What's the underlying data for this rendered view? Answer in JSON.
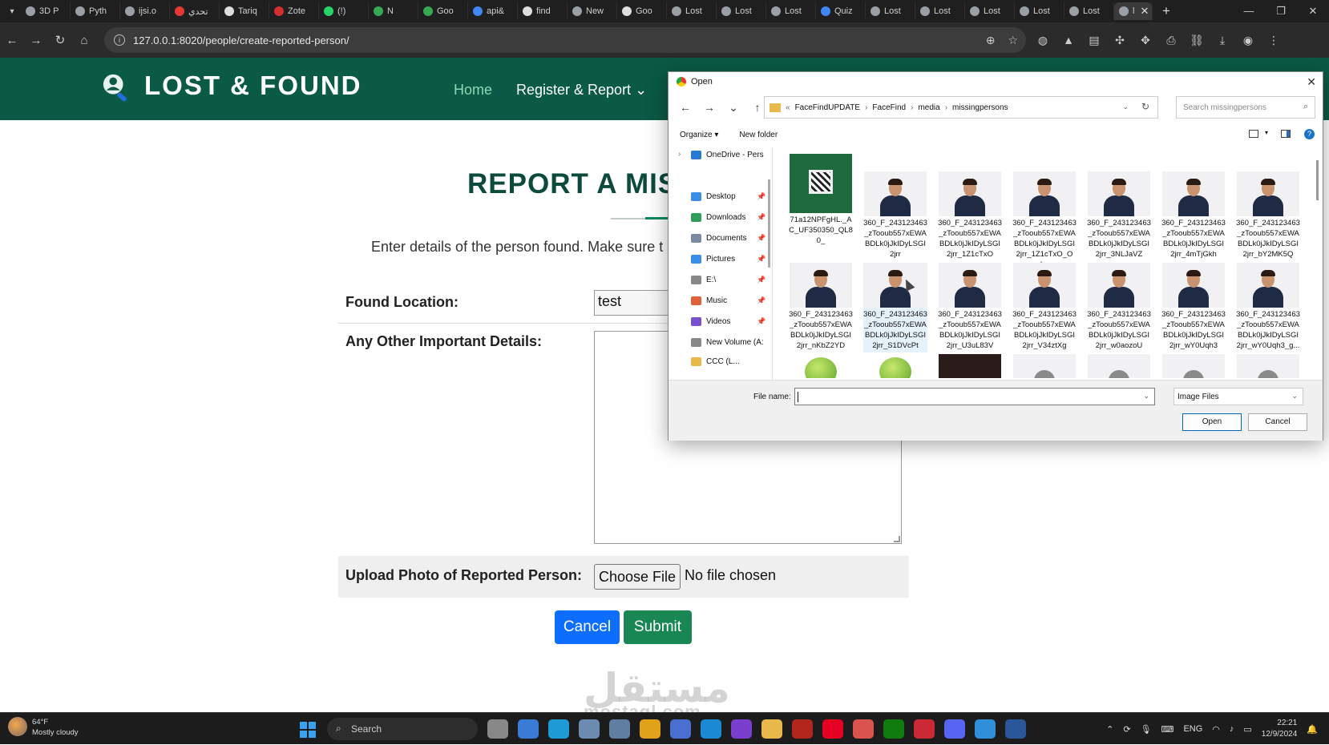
{
  "browser": {
    "tabs": [
      {
        "label": "3D P",
        "color": "#9aa0a6"
      },
      {
        "label": "Pyth",
        "color": "#9aa0a6"
      },
      {
        "label": "ijsi.o",
        "color": "#9aa0a6"
      },
      {
        "label": "تحدي",
        "color": "#e53935"
      },
      {
        "label": "Tariq",
        "color": "#dddddd"
      },
      {
        "label": "Zote",
        "color": "#d32f2f"
      },
      {
        "label": "(!)",
        "color": "#25d366"
      },
      {
        "label": "N",
        "color": "#34a853"
      },
      {
        "label": "Goo",
        "color": "#34a853"
      },
      {
        "label": "api&",
        "color": "#4285f4"
      },
      {
        "label": "find",
        "color": "#dddddd"
      },
      {
        "label": "New",
        "color": "#9aa0a6"
      },
      {
        "label": "Goo",
        "color": "#dddddd"
      },
      {
        "label": "Lost",
        "color": "#9aa0a6"
      },
      {
        "label": "Lost",
        "color": "#9aa0a6"
      },
      {
        "label": "Lost",
        "color": "#9aa0a6"
      },
      {
        "label": "Quiz",
        "color": "#4285f4"
      },
      {
        "label": "Lost",
        "color": "#9aa0a6"
      },
      {
        "label": "Lost",
        "color": "#9aa0a6"
      },
      {
        "label": "Lost",
        "color": "#9aa0a6"
      },
      {
        "label": "Lost",
        "color": "#9aa0a6"
      },
      {
        "label": "Lost",
        "color": "#9aa0a6"
      },
      {
        "label": "l",
        "color": "#9aa0a6",
        "active": true
      }
    ],
    "url": "127.0.0.1:8020/people/create-reported-person/"
  },
  "site": {
    "logo_text": "LOST & FOUND",
    "nav_home": "Home",
    "nav_register": "Register & Report",
    "nav_register_icon": "chevron-down-icon",
    "brand_color": "#0a5a45"
  },
  "form": {
    "title": "REPORT A MIS",
    "intro": "Enter details of the person found. Make sure t",
    "found_location_label": "Found Location:",
    "found_location_value": "test",
    "details_label": "Any Other Important Details:",
    "upload_label": "Upload Photo of Reported Person:",
    "choose_file": "Choose File",
    "no_file": "No file chosen",
    "cancel": "Cancel",
    "submit": "Submit"
  },
  "watermark": {
    "arabic": "مستقل",
    "latin": "mostaql.com"
  },
  "dialog": {
    "title": "Open",
    "path": [
      "FaceFindUPDATE",
      "FaceFind",
      "media",
      "missingpersons"
    ],
    "path_prefix": "«",
    "search_placeholder": "Search missingpersons",
    "organize": "Organize",
    "new_folder": "New folder",
    "tree": [
      {
        "label": "OneDrive - Pers",
        "color": "#2a7ad5",
        "pinned": false
      },
      {
        "label": "Desktop",
        "color": "#3a8ee6",
        "pinned": true
      },
      {
        "label": "Downloads",
        "color": "#2f9e5b",
        "pinned": true
      },
      {
        "label": "Documents",
        "color": "#7a8aa0",
        "pinned": true
      },
      {
        "label": "Pictures",
        "color": "#3a8ee6",
        "pinned": true
      },
      {
        "label": "E:\\",
        "color": "#888888",
        "pinned": true
      },
      {
        "label": "Music",
        "color": "#e0623a",
        "pinned": true
      },
      {
        "label": "Videos",
        "color": "#7a4fd0",
        "pinned": true
      },
      {
        "label": "New Volume (A:",
        "color": "#888888",
        "pinned": false
      },
      {
        "label": "CCC (L...",
        "color": "#e9b84a",
        "pinned": false
      }
    ],
    "files": [
      {
        "name": "71a12NPFgHL._AC_UF350350_QL80_",
        "kind": "bag"
      },
      {
        "name": "360_F_243123463_zTooub557xEWABDLk0jJkIDyLSGI2jrr",
        "kind": "person"
      },
      {
        "name": "360_F_243123463_zTooub557xEWABDLk0jJkIDyLSGI2jrr_1Z1cTxO",
        "kind": "person"
      },
      {
        "name": "360_F_243123463_zTooub557xEWABDLk0jJkIDyLSGI2jrr_1Z1cTxO_Ol...",
        "kind": "person"
      },
      {
        "name": "360_F_243123463_zTooub557xEWABDLk0jJkIDyLSGI2jrr_3NLJaVZ",
        "kind": "person"
      },
      {
        "name": "360_F_243123463_zTooub557xEWABDLk0jJkIDyLSGI2jrr_4mTjGkh",
        "kind": "person"
      },
      {
        "name": "360_F_243123463_zTooub557xEWABDLk0jJkIDyLSGI2jrr_bY2MK5Q",
        "kind": "person"
      },
      {
        "name": "360_F_243123463_zTooub557xEWABDLk0jJkIDyLSGI2jrr_nKbZ2YD",
        "kind": "person"
      },
      {
        "name": "360_F_243123463_zTooub557xEWABDLk0jJkIDyLSGI2jrr_S1DVcPt",
        "kind": "person",
        "selected": true
      },
      {
        "name": "360_F_243123463_zTooub557xEWABDLk0jJkIDyLSGI2jrr_U3uL83V",
        "kind": "person"
      },
      {
        "name": "360_F_243123463_zTooub557xEWABDLk0jJkIDyLSGI2jrr_V34ztXg",
        "kind": "person"
      },
      {
        "name": "360_F_243123463_zTooub557xEWABDLk0jJkIDyLSGI2jrr_w0aozoU",
        "kind": "person"
      },
      {
        "name": "360_F_243123463_zTooub557xEWABDLk0jJkIDyLSGI2jrr_wY0Uqh3",
        "kind": "person"
      },
      {
        "name": "360_F_243123463_zTooub557xEWABDLk0jJkIDyLSGI2jrr_wY0Uqh3_g...",
        "kind": "person"
      },
      {
        "name": "",
        "kind": "apple"
      },
      {
        "name": "",
        "kind": "apple"
      },
      {
        "name": "",
        "kind": "dark"
      },
      {
        "name": "",
        "kind": "gray"
      },
      {
        "name": "",
        "kind": "gray"
      },
      {
        "name": "",
        "kind": "gray"
      },
      {
        "name": "",
        "kind": "gray"
      }
    ],
    "file_name_label": "File name:",
    "file_name_value": "",
    "file_type": "Image Files",
    "open": "Open",
    "cancel": "Cancel"
  },
  "taskbar": {
    "temp": "64°F",
    "weather": "Mostly cloudy",
    "search": "Search",
    "language": "ENG",
    "time": "22:21",
    "date": "12/9/2024",
    "apps": [
      {
        "name": "file-explorer-app-icon",
        "color": "#888888"
      },
      {
        "name": "copilot-app-icon",
        "color": "#3a7bd5"
      },
      {
        "name": "edge-app-icon",
        "color": "#1e9bd7"
      },
      {
        "name": "snipping-app-icon",
        "color": "#6b8cb0"
      },
      {
        "name": "store-app-icon",
        "color": "#5f7ea0"
      },
      {
        "name": "chrome-app-icon",
        "color": "#e0a21a"
      },
      {
        "name": "app-generic-icon",
        "color": "#4a6fd0"
      },
      {
        "name": "vscode-app-icon",
        "color": "#1a8ad4"
      },
      {
        "name": "visual-studio-app-icon",
        "color": "#7b3fd0"
      },
      {
        "name": "folder-app-icon",
        "color": "#e9b84a"
      },
      {
        "name": "app-red-icon",
        "color": "#b3261e"
      },
      {
        "name": "pinterest-app-icon",
        "color": "#e60023"
      },
      {
        "name": "chrome-profile-app-icon",
        "color": "#d9534f"
      },
      {
        "name": "xbox-app-icon",
        "color": "#107c10"
      },
      {
        "name": "zotero-app-icon",
        "color": "#cc2936"
      },
      {
        "name": "discord-app-icon",
        "color": "#5865f2"
      },
      {
        "name": "app-blue-icon",
        "color": "#2f8fd8"
      },
      {
        "name": "word-app-icon",
        "color": "#2b579a"
      }
    ]
  }
}
